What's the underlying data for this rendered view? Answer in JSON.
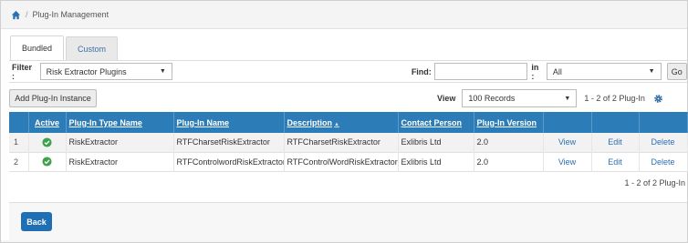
{
  "breadcrumb": {
    "page": "Plug-In Management"
  },
  "tabs": [
    {
      "label": "Bundled",
      "active": true
    },
    {
      "label": "Custom",
      "active": false
    }
  ],
  "filter": {
    "label": "Filter :",
    "value": "Risk Extractor Plugins",
    "find_label": "Find:",
    "find_value": "",
    "in_label": "in :",
    "in_value": "All",
    "go_label": "Go"
  },
  "toolbar": {
    "add_button": "Add Plug-In Instance",
    "view_label": "View",
    "view_value": "100 Records",
    "pager": "1 - 2 of 2 Plug-In"
  },
  "table": {
    "columns": [
      "Active",
      "Plug-In Type Name",
      "Plug-In Name",
      "Description",
      "Contact Person",
      "Plug-In Version"
    ],
    "rows": [
      {
        "num": "1",
        "type_name": "RiskExtractor",
        "name": "RTFCharsetRiskExtractor",
        "description": "RTFCharsetRiskExtractor",
        "contact": "Exlibris Ltd",
        "version": "2.0",
        "view": "View",
        "edit": "Edit",
        "delete": "Delete"
      },
      {
        "num": "2",
        "type_name": "RiskExtractor",
        "name": "RTFControlwordRiskExtractor",
        "description": "RTFControlWordRiskExtractor",
        "contact": "Exlibris Ltd",
        "version": "2.0",
        "view": "View",
        "edit": "Edit",
        "delete": "Delete"
      }
    ]
  },
  "pager_bottom": "1 - 2 of 2 Plug-In",
  "footer": {
    "back_label": "Back"
  },
  "colors": {
    "header_blue": "#2c7cb8",
    "link_blue": "#2d6fb5",
    "active_green": "#3fa14a",
    "back_button": "#1f6fb5"
  }
}
